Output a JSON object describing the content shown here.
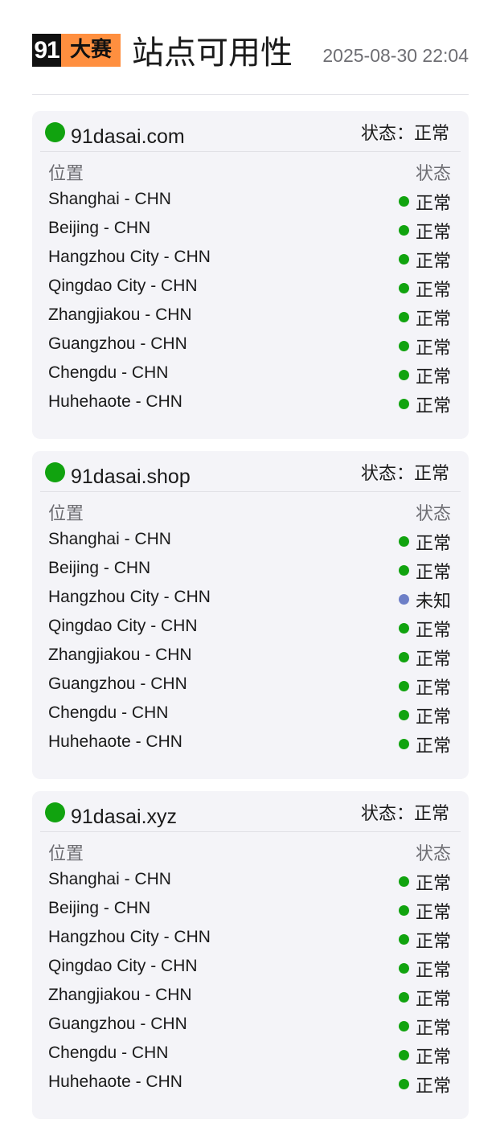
{
  "header": {
    "logo_num": "91",
    "logo_word": "大赛",
    "title": "站点可用性",
    "timestamp": "2025-08-30 22:04"
  },
  "colors": {
    "ok": "#11a30f",
    "unknown": "#6d7fc7",
    "logo_accent": "#ff8f3f"
  },
  "sites": [
    {
      "name": "91dasai.com",
      "status": "状态：正常",
      "col_location": "位置",
      "col_status": "状态",
      "rows": [
        {
          "location": "Shanghai - CHN",
          "status": "正常",
          "state": "ok"
        },
        {
          "location": "Beijing - CHN",
          "status": "正常",
          "state": "ok"
        },
        {
          "location": "Hangzhou City - CHN",
          "status": "正常",
          "state": "ok"
        },
        {
          "location": "Qingdao City - CHN",
          "status": "正常",
          "state": "ok"
        },
        {
          "location": "Zhangjiakou - CHN",
          "status": "正常",
          "state": "ok"
        },
        {
          "location": "Guangzhou - CHN",
          "status": "正常",
          "state": "ok"
        },
        {
          "location": "Chengdu - CHN",
          "status": "正常",
          "state": "ok"
        },
        {
          "location": "Huhehaote - CHN",
          "status": "正常",
          "state": "ok"
        }
      ]
    },
    {
      "name": "91dasai.shop",
      "status": "状态：正常",
      "col_location": "位置",
      "col_status": "状态",
      "rows": [
        {
          "location": "Shanghai - CHN",
          "status": "正常",
          "state": "ok"
        },
        {
          "location": "Beijing - CHN",
          "status": "正常",
          "state": "ok"
        },
        {
          "location": "Hangzhou City - CHN",
          "status": "未知",
          "state": "unknown"
        },
        {
          "location": "Qingdao City - CHN",
          "status": "正常",
          "state": "ok"
        },
        {
          "location": "Zhangjiakou - CHN",
          "status": "正常",
          "state": "ok"
        },
        {
          "location": "Guangzhou - CHN",
          "status": "正常",
          "state": "ok"
        },
        {
          "location": "Chengdu - CHN",
          "status": "正常",
          "state": "ok"
        },
        {
          "location": "Huhehaote - CHN",
          "status": "正常",
          "state": "ok"
        }
      ]
    },
    {
      "name": "91dasai.xyz",
      "status": "状态：正常",
      "col_location": "位置",
      "col_status": "状态",
      "rows": [
        {
          "location": "Shanghai - CHN",
          "status": "正常",
          "state": "ok"
        },
        {
          "location": "Beijing - CHN",
          "status": "正常",
          "state": "ok"
        },
        {
          "location": "Hangzhou City - CHN",
          "status": "正常",
          "state": "ok"
        },
        {
          "location": "Qingdao City - CHN",
          "status": "正常",
          "state": "ok"
        },
        {
          "location": "Zhangjiakou - CHN",
          "status": "正常",
          "state": "ok"
        },
        {
          "location": "Guangzhou - CHN",
          "status": "正常",
          "state": "ok"
        },
        {
          "location": "Chengdu - CHN",
          "status": "正常",
          "state": "ok"
        },
        {
          "location": "Huhehaote - CHN",
          "status": "正常",
          "state": "ok"
        }
      ]
    }
  ]
}
